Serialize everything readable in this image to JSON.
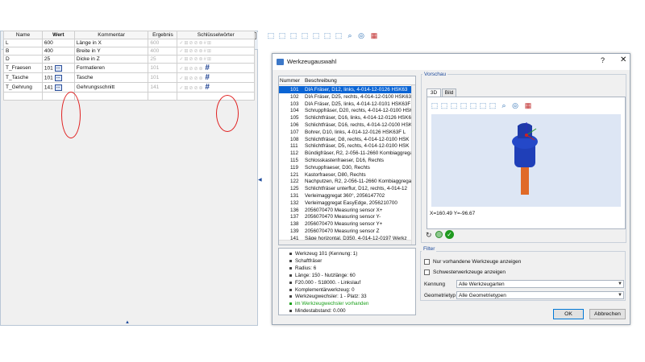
{
  "left_panel": {
    "close_glyph": "⊠",
    "tabs": [
      {
        "icon": "magic-wand-icon"
      },
      {
        "icon": "copy-doc-icon"
      },
      {
        "icon": "table-list-icon"
      },
      {
        "icon": "sheet-icon"
      }
    ],
    "columns": [
      "Name",
      "Wert",
      "Kommentar",
      "Ergebnis",
      "Schlüsselwörter"
    ],
    "rows": [
      {
        "name": "L",
        "wert": "600",
        "kommentar": "Länge in X",
        "ergebnis": "600",
        "keywords": "✓⊞⊘⊘⊛#⊞"
      },
      {
        "name": "B",
        "wert": "400",
        "kommentar": "Breite in Y",
        "ergebnis": "400",
        "keywords": "✓⊞⊘⊘⊛#⊞"
      },
      {
        "name": "D",
        "wert": "25",
        "kommentar": "Dicke in Z",
        "ergebnis": "25",
        "keywords": "✓⊞⊘⊘⊛#⊞"
      },
      {
        "name": "T_Fraesen",
        "wert": "101",
        "dots": "...",
        "kommentar": "Formatieren",
        "ergebnis": "101",
        "keywords": "✓⊞⊘⊘⊛",
        "hash": "#"
      },
      {
        "name": "T_Tasche",
        "wert": "101",
        "dots": "...",
        "kommentar": "Tasche",
        "ergebnis": "101",
        "keywords": "✓⊞⊘⊘⊛",
        "hash": "#"
      },
      {
        "name": "T_Gehrung",
        "wert": "141",
        "dots": "...",
        "kommentar": "Gehrungsschnitt",
        "ergebnis": "141",
        "keywords": "✓⊞⊘⊘⊛",
        "hash": "#"
      }
    ],
    "collapse_arrow": "▲"
  },
  "splitter_arrow": "◀",
  "dialog": {
    "title": "Werkzeugauswahl",
    "help": "?",
    "close": "✕",
    "list": {
      "header_num": "Nummer",
      "header_desc": "Beschreibung",
      "items": [
        {
          "num": "101",
          "desc": "DIA Fräser, D12, links, 4-014-12-0126 HSK63",
          "selected": true
        },
        {
          "num": "102",
          "desc": "DIA Fräser, D25, rechts, 4-014-12-0100 HSK63F"
        },
        {
          "num": "103",
          "desc": "DIA Fräser, D25, links, 4-014-12-0101 HSK63F"
        },
        {
          "num": "104",
          "desc": "Schruppfräser, D20, rechts, 4-014-12-0100 HSK63"
        },
        {
          "num": "105",
          "desc": "Schlichtfräser, D16, links, 4-014-12-0126 HSK63"
        },
        {
          "num": "106",
          "desc": "Schlichtfräser, D16, rechts, 4-014-12-0100 HSK"
        },
        {
          "num": "107",
          "desc": "Bohrer, D10, links, 4-014-12-0126 HSK63F L"
        },
        {
          "num": "108",
          "desc": "Schlichtfräser, D8, rechts, 4-014-12-0100 HSK"
        },
        {
          "num": "111",
          "desc": "Schlichtfräser, D5, rechts, 4-014-12-0100 HSK"
        },
        {
          "num": "112",
          "desc": "Bündigfräser, R2, 2-056-11-2660 Kombiaggregat"
        },
        {
          "num": "115",
          "desc": "Schlosskastenfraeser, D16, Rechts"
        },
        {
          "num": "119",
          "desc": "Schruppfraeser, D30, Rechts"
        },
        {
          "num": "121",
          "desc": "Kastorfraeser, D80, Rechts"
        },
        {
          "num": "122",
          "desc": "Nachputzen, R2, 2-056-11-2660 Kombiaggregat"
        },
        {
          "num": "125",
          "desc": "Schlichtfräser unterflur, D12, rechts, 4-014-12"
        },
        {
          "num": "131",
          "desc": "Verleimaggregat 360°, 2056147702"
        },
        {
          "num": "132",
          "desc": "Verleimaggregat EasyEdge, 2056210700"
        },
        {
          "num": "136",
          "desc": "2056070470 Measuring sensor X+"
        },
        {
          "num": "137",
          "desc": "2056070470 Measuring sensor Y-"
        },
        {
          "num": "138",
          "desc": "2056070470 Measuring sensor Y+"
        },
        {
          "num": "139",
          "desc": "2056070470 Measuring sensor Z"
        },
        {
          "num": "141",
          "desc": "Säge horizontal, D350, 4-014-12-0197 Werkz"
        }
      ]
    },
    "info": [
      {
        "text": "Werkzeug 101 (Kennung: 1)"
      },
      {
        "text": "Schaftfräser"
      },
      {
        "text": "Radius: 6"
      },
      {
        "text": "Länge: 150 - Nutzlänge: 60"
      },
      {
        "text": "F20.000 - S18000. - Linkslauf"
      },
      {
        "text": "Komplementärwerkzeug: 0"
      },
      {
        "text": "Werkzeugwechsler: 1 - Platz: 33"
      },
      {
        "text": "im Werkzeugwechsler vorhanden",
        "green": true
      },
      {
        "text": "Mindestabstand: 0.000"
      }
    ],
    "preview": {
      "label": "Vorschau",
      "tabs": [
        "3D",
        "Bild"
      ],
      "coords": "X=160.49 Y=-96.67"
    },
    "filter": {
      "label": "Filter",
      "check1": "Nur vorhandene Werkzeuge anzeigen",
      "check2": "Schwesterwerkzeuge anzeigen",
      "kennung_label": "Kennung",
      "kennung_value": "Alle Werkzeugarten",
      "geo_label": "Geometrietyp",
      "geo_value": "Alle Geometrietypen"
    },
    "ok": "OK",
    "cancel": "Abbrechen"
  }
}
